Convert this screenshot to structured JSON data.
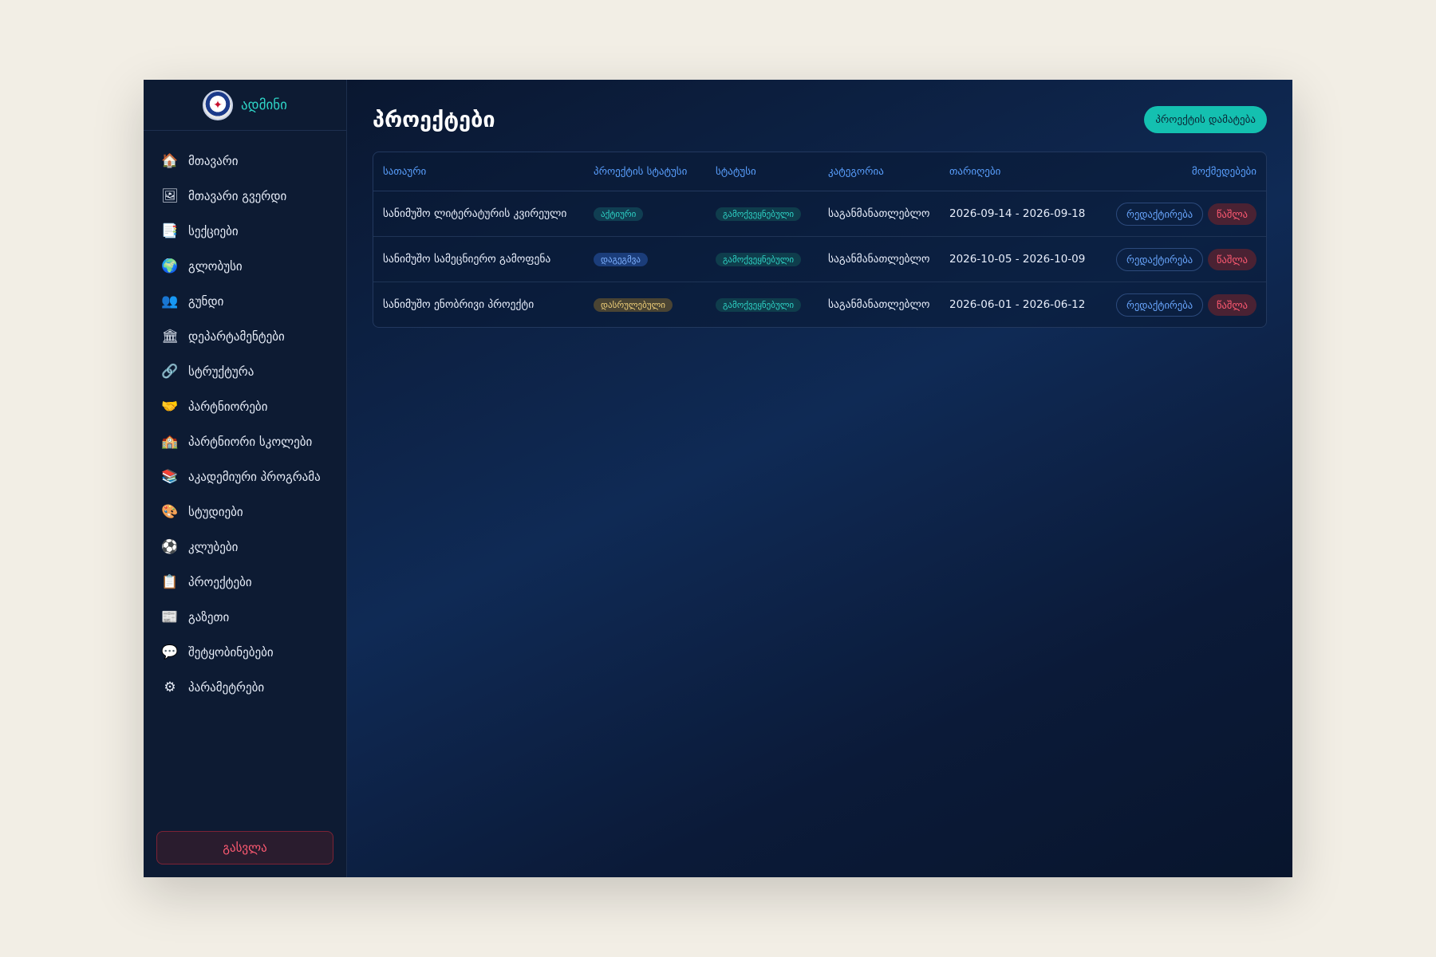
{
  "brand": {
    "name": "ადმინი",
    "logo_icon": "school-crest-logo"
  },
  "sidebar": {
    "items": [
      {
        "label": "მთავარი",
        "icon": "🏠"
      },
      {
        "label": "მთავარი გვერდი",
        "icon": "🖼"
      },
      {
        "label": "სექციები",
        "icon": "📑"
      },
      {
        "label": "გლობუსი",
        "icon": "🌍"
      },
      {
        "label": "გუნდი",
        "icon": "👥"
      },
      {
        "label": "დეპარტამენტები",
        "icon": "🏛"
      },
      {
        "label": "სტრუქტურა",
        "icon": "🔗"
      },
      {
        "label": "პარტნიორები",
        "icon": "🤝"
      },
      {
        "label": "პარტნიორი სკოლები",
        "icon": "🏫"
      },
      {
        "label": "აკადემიური პროგრამა",
        "icon": "📚"
      },
      {
        "label": "სტუდიები",
        "icon": "🎨"
      },
      {
        "label": "კლუბები",
        "icon": "⚽"
      },
      {
        "label": "პროექტები",
        "icon": "📋"
      },
      {
        "label": "გაზეთი",
        "icon": "📰"
      },
      {
        "label": "შეტყობინებები",
        "icon": "💬"
      },
      {
        "label": "პარამეტრები",
        "icon": "⚙"
      }
    ],
    "logout_label": "გასვლა"
  },
  "header": {
    "title": "პროექტები",
    "add_button": "პროექტის დამატება"
  },
  "table": {
    "columns": [
      "სათაური",
      "პროექტის სტატუსი",
      "სტატუსი",
      "კატეგორია",
      "თარიღები",
      "მოქმედებები"
    ],
    "rows": [
      {
        "title": "სანიმუშო ლიტერატურის კვირეული",
        "project_status": "აქტიური",
        "status": "გამოქვეყნებული",
        "category": "საგანმანათლებლო",
        "dates": "2026-09-14 - 2026-09-18",
        "edit": "რედაქტირება",
        "delete": "წაშლა"
      },
      {
        "title": "სანიმუშო სამეცნიერო გამოფენა",
        "project_status": "დაგეგმვა",
        "status": "გამოქვეყნებული",
        "category": "საგანმანათლებლო",
        "dates": "2026-10-05 - 2026-10-09",
        "edit": "რედაქტირება",
        "delete": "წაშლა"
      },
      {
        "title": "სანიმუშო ენობრივი პროექტი",
        "project_status": "დასრულებული",
        "status": "გამოქვეყნებული",
        "category": "საგანმანათლებლო",
        "dates": "2026-06-01 - 2026-06-12",
        "edit": "რედაქტირება",
        "delete": "წაშლა"
      }
    ]
  },
  "colors": {
    "accent": "#14c0b0",
    "sidebar_bg": "#0d1b33",
    "danger": "#ff5a72",
    "link": "#5aa0ff"
  }
}
